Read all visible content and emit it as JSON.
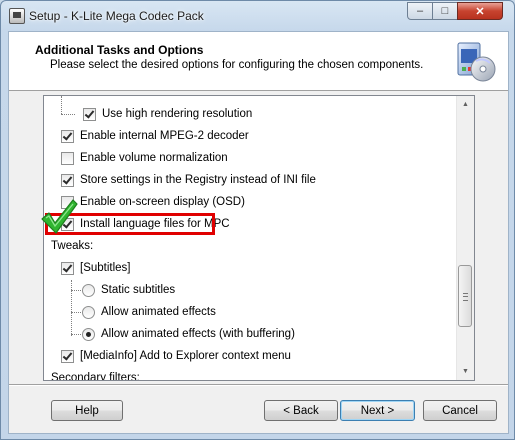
{
  "window": {
    "title": "Setup - K-Lite Mega Codec Pack",
    "minimize_glyph": "–",
    "maximize_glyph": "□",
    "close_glyph": "✕"
  },
  "header": {
    "title": "Additional Tasks and Options",
    "subtitle": "Please select the desired options for configuring the chosen components.",
    "logo_icon": "codec-pack-box-icon"
  },
  "options": [
    {
      "label": "Use high rendering resolution",
      "type": "checkbox",
      "checked": true
    },
    {
      "label": "Enable internal MPEG-2 decoder",
      "type": "checkbox",
      "checked": true
    },
    {
      "label": "Enable volume normalization",
      "type": "checkbox",
      "checked": false
    },
    {
      "label": "Store settings in the Registry instead of INI file",
      "type": "checkbox",
      "checked": true
    },
    {
      "label": "Enable on-screen display (OSD)",
      "type": "checkbox",
      "checked": false
    },
    {
      "label": "Install language files for MPC",
      "type": "checkbox",
      "checked": true
    },
    {
      "label": "Tweaks:",
      "type": "heading"
    },
    {
      "label": "[Subtitles]",
      "type": "checkbox",
      "checked": true
    },
    {
      "label": "Static subtitles",
      "type": "radio",
      "selected": false
    },
    {
      "label": "Allow animated effects",
      "type": "radio",
      "selected": false
    },
    {
      "label": "Allow animated effects (with buffering)",
      "type": "radio",
      "selected": true
    },
    {
      "label": "[MediaInfo] Add to Explorer context menu",
      "type": "checkbox",
      "checked": true
    },
    {
      "label": "Secondary filters:",
      "type": "heading"
    }
  ],
  "annotation": {
    "highlight_color": "#e00000",
    "checkmark_color": "#2fb52f"
  },
  "buttons": {
    "help": "Help",
    "back": "< Back",
    "next": "Next >",
    "cancel": "Cancel"
  }
}
